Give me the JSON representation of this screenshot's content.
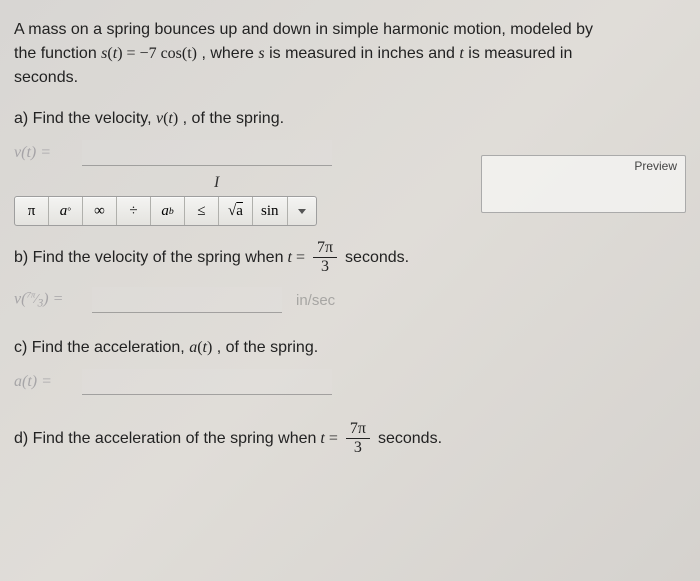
{
  "intro": {
    "line1_a": "A mass on a spring bounces up and down in simple harmonic motion, modeled by",
    "line2_a": "the function ",
    "func_lhs": "s(t) = ",
    "func_rhs": "−7 cos(t)",
    "line2_b": ", where ",
    "var_s": "s",
    "measured_in": " is measured in inches and ",
    "var_t": "t",
    "line2_c": " is measured in",
    "line3": "seconds."
  },
  "parts": {
    "a": {
      "prompt_a": "a) Find the velocity, ",
      "prompt_func": "v(t)",
      "prompt_b": ", of the spring.",
      "ghost": "v(t) =",
      "cursor": "I"
    },
    "b": {
      "prompt_a": "b) Find the velocity of the spring when ",
      "eq_lhs": "t =",
      "frac_num": "7π",
      "frac_den": "3",
      "prompt_b": " seconds.",
      "ghost": "v(7π/3) =",
      "unit": "in/sec"
    },
    "c": {
      "prompt_a": "c) Find the acceleration, ",
      "prompt_func": "a(t)",
      "prompt_b": ", of the spring.",
      "ghost": "a(t) ="
    },
    "d": {
      "prompt_a": "d) Find the acceleration of the spring when ",
      "eq_lhs": "t =",
      "frac_num": "7π",
      "frac_den": "3",
      "prompt_b": " seconds."
    }
  },
  "toolbar": {
    "pi": "π",
    "adeg": "a°",
    "inf": "∞",
    "div": "÷",
    "pow": "aᵇ",
    "leq": "≤",
    "sqrt": "√a",
    "sin": "sin"
  },
  "preview": {
    "label": "Preview"
  }
}
